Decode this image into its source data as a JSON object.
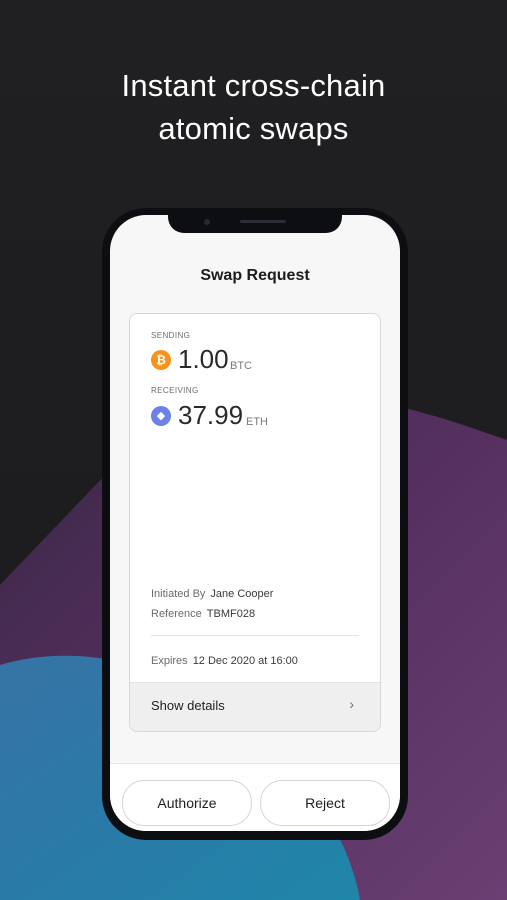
{
  "headline": {
    "line1": "Instant cross-chain",
    "line2": "atomic swaps"
  },
  "screen": {
    "title": "Swap Request",
    "sending": {
      "label": "SENDING",
      "amount": "1.00",
      "unit": "BTC",
      "icon": "bitcoin-icon",
      "icon_glyph": "₿",
      "color": "#f7931a"
    },
    "receiving": {
      "label": "RECEIVING",
      "amount": "37.99",
      "unit": "ETH",
      "icon": "ethereum-icon",
      "icon_glyph": "◆",
      "color": "#6c82e8"
    },
    "initiated_by": {
      "label": "Initiated By",
      "value": "Jane Cooper"
    },
    "reference": {
      "label": "Reference",
      "value": "TBMF028"
    },
    "expires": {
      "label": "Expires",
      "value": "12 Dec 2020 at 16:00"
    },
    "details_label": "Show details",
    "details_chevron": "›"
  },
  "buttons": {
    "authorize": "Authorize",
    "reject": "Reject"
  },
  "colors": {
    "background": "#1e1e20",
    "accent_purple": "#4b2f5e",
    "accent_blue": "#2e6f9e"
  }
}
